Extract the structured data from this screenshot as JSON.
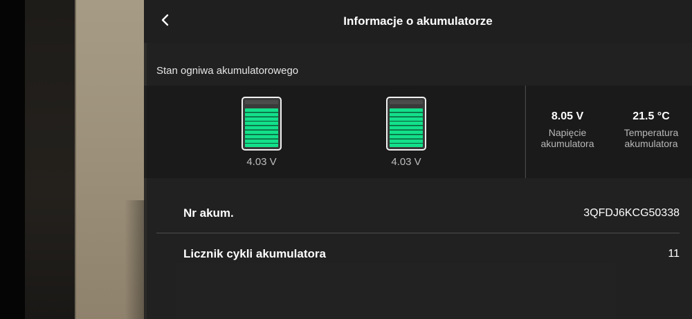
{
  "header": {
    "title": "Informacje o akumulatorze",
    "back_icon": "chevron-left-icon"
  },
  "cells_section": {
    "label": "Stan ogniwa akumulatorowego",
    "cells": [
      {
        "voltage": "4.03 V",
        "charge_fraction": 0.87
      },
      {
        "voltage": "4.03 V",
        "charge_fraction": 0.87
      }
    ],
    "cell_fill_color": "#13e08a"
  },
  "stats": {
    "voltage": {
      "value": "8.05 V",
      "label_line1": "Napięcie",
      "label_line2": "akumulatora"
    },
    "temperature": {
      "value": "21.5 °C",
      "label_line1": "Temperatura",
      "label_line2": "akumulatora"
    }
  },
  "rows": [
    {
      "label": "Nr akum.",
      "value": "3QFDJ6KCG50338"
    },
    {
      "label": "Licznik cykli akumulatora",
      "value": "11"
    }
  ]
}
